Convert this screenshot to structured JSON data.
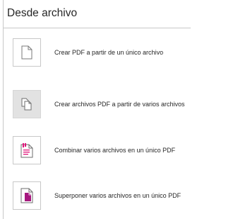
{
  "panel": {
    "title": "Desde archivo",
    "items": [
      {
        "label": "Crear PDF a partir de un único archivo",
        "icon": "single-page-icon",
        "selected": false
      },
      {
        "label": "Crear archivos PDF a partir de varios archivos",
        "icon": "multiple-pages-icon",
        "selected": true
      },
      {
        "label": "Combinar varios archivos en un único PDF",
        "icon": "combine-pdf-icon",
        "selected": false
      },
      {
        "label": "Superponer varios archivos en un único PDF",
        "icon": "overlay-pdf-icon",
        "selected": false
      }
    ]
  },
  "colors": {
    "accent_pink": "#e0147a",
    "accent_magenta": "#a6187e",
    "selected_bg": "#e2e2e2",
    "border": "#c8c8c8"
  }
}
